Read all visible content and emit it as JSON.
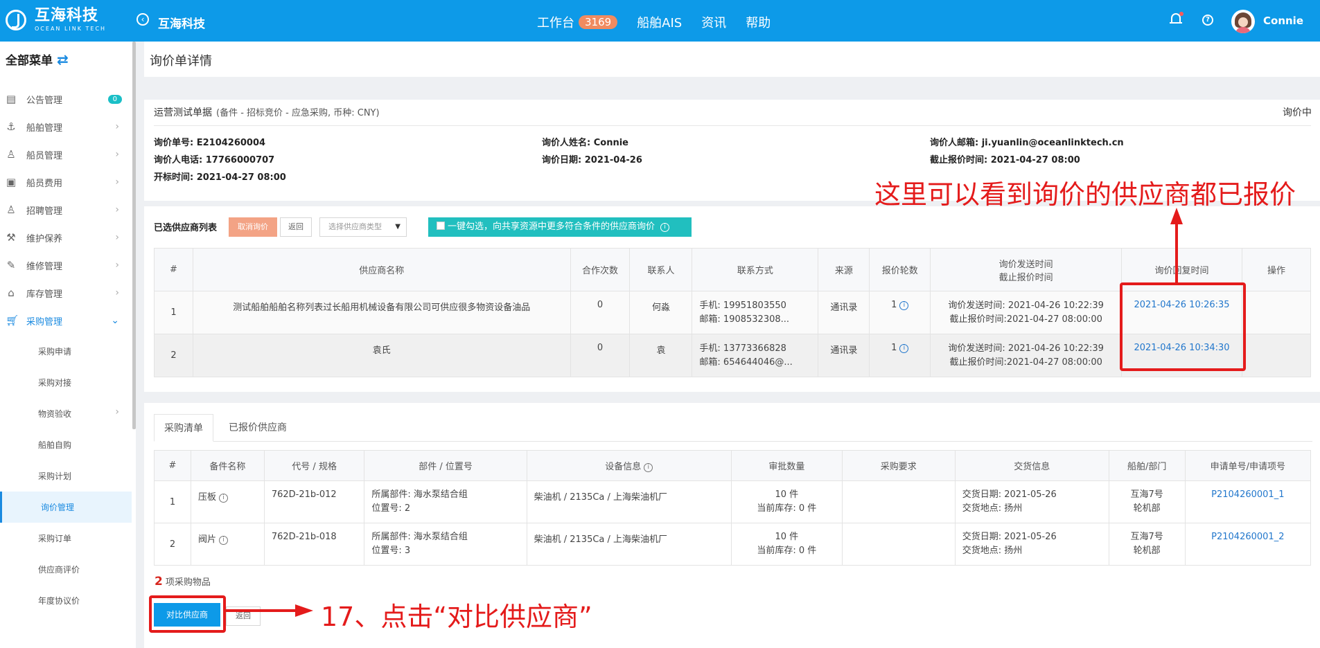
{
  "topbar": {
    "logo_cn": "互海科技",
    "logo_en": "OCEAN LINK TECH",
    "back_title": "互海科技",
    "nav": [
      {
        "label": "工作台",
        "badge": "3169"
      },
      {
        "label": "船舶AIS"
      },
      {
        "label": "资讯"
      },
      {
        "label": "帮助"
      }
    ],
    "user_name": "Connie"
  },
  "sidebar": {
    "header": "全部菜单",
    "items": [
      {
        "label": "公告管理",
        "icon": "book-icon",
        "badge": "0"
      },
      {
        "label": "船舶管理",
        "icon": "anchor-icon"
      },
      {
        "label": "船员管理",
        "icon": "person-icon"
      },
      {
        "label": "船员费用",
        "icon": "wallet-icon"
      },
      {
        "label": "招聘管理",
        "icon": "recruit-icon"
      },
      {
        "label": "维护保养",
        "icon": "wrench-icon"
      },
      {
        "label": "维修管理",
        "icon": "tool-icon"
      },
      {
        "label": "库存管理",
        "icon": "home-icon"
      },
      {
        "label": "采购管理",
        "icon": "cart-icon"
      }
    ],
    "subitems": [
      {
        "label": "采购申请"
      },
      {
        "label": "采购对接"
      },
      {
        "label": "物资验收"
      },
      {
        "label": "船舶自购"
      },
      {
        "label": "采购计划"
      },
      {
        "label": "询价管理"
      },
      {
        "label": "采购订单"
      },
      {
        "label": "供应商评价"
      },
      {
        "label": "年度协议价"
      }
    ]
  },
  "page": {
    "title": "询价单详情",
    "doc_name": "运营测试单据",
    "doc_sub": "(备件 - 招标竞价 - 应急采购, 币种: CNY)",
    "status": "询价中",
    "info": {
      "no": "询价单号: E2104260004",
      "phone": "询价人电话: 17766000707",
      "open_time": "开标时间: 2021-04-27 08:00",
      "name": "询价人姓名: Connie",
      "date": "询价日期: 2021-04-26",
      "email": "询价人邮箱: ji.yuanlin@oceanlinktech.cn",
      "deadline": "截止报价时间: 2021-04-27 08:00"
    }
  },
  "suppliers": {
    "label": "已选供应商列表",
    "cancel_btn": "取消询价",
    "back_btn": "返回",
    "type_select": "选择供应商类型",
    "share_text": "一键勾选，向共享资源中更多符合条件的供应商询价",
    "headers": [
      "#",
      "供应商名称",
      "合作次数",
      "联系人",
      "联系方式",
      "来源",
      "报价轮数",
      "询价发送时间",
      "截止报价时间",
      "询价回复时间",
      "操作"
    ],
    "rows": [
      {
        "idx": "1",
        "name": "测试船舶船舶名称列表过长船用机械设备有限公司可供应很多物资设备油品",
        "coop": "0",
        "contact": "何淼",
        "mobile": "手机:  19951803550",
        "email": "邮箱:  1908532308...",
        "source": "通讯录",
        "rounds": "1",
        "send": "询价发送时间: 2021-04-26 10:22:39",
        "deadline": "截止报价时间:2021-04-27 08:00:00",
        "reply": "2021-04-26 10:26:35"
      },
      {
        "idx": "2",
        "name": "袁氏",
        "coop": "0",
        "contact": "袁",
        "mobile": "手机:  13773366828",
        "email": "邮箱:  654644046@...",
        "source": "通讯录",
        "rounds": "1",
        "send": "询价发送时间: 2021-04-26 10:22:39",
        "deadline": "截止报价时间:2021-04-27 08:00:00",
        "reply": "2021-04-26 10:34:30"
      }
    ]
  },
  "purchase": {
    "tabs": [
      "采购清单",
      "已报价供应商"
    ],
    "headers": [
      "#",
      "备件名称",
      "代号 / 规格",
      "部件 / 位置号",
      "设备信息",
      "审批数量",
      "采购要求",
      "交货信息",
      "船舶/部门",
      "申请单号/申请项号"
    ],
    "rows": [
      {
        "idx": "1",
        "name": "压板",
        "code": "762D-21b-012",
        "part": "所属部件:  海水泵结合组",
        "pos": "位置号:  2",
        "equip": "柴油机 / 2135Ca / 上海柴油机厂",
        "qty": "10 件",
        "stock": "当前库存:  0 件",
        "req": "",
        "del_date": "交货日期:    2021-05-26",
        "del_place": "交货地点:  扬州",
        "ship": "互海7号",
        "dept": "轮机部",
        "apply": "P2104260001_1"
      },
      {
        "idx": "2",
        "name": "阀片",
        "code": "762D-21b-018",
        "part": "所属部件:  海水泵结合组",
        "pos": "位置号:  3",
        "equip": "柴油机 / 2135Ca / 上海柴油机厂",
        "qty": "10 件",
        "stock": "当前库存:  0 件",
        "req": "",
        "del_date": "交货日期:    2021-05-26",
        "del_place": "交货地点:  扬州",
        "ship": "互海7号",
        "dept": "轮机部",
        "apply": "P2104260001_2"
      }
    ],
    "count": "2",
    "count_label": "项采购物品",
    "compare_btn": "对比供应商",
    "back_btn": "返回"
  },
  "annotations": {
    "top": "这里可以看到询价的供应商都已报价",
    "bottom": "17、点击“对比供应商”",
    "color": "#e41b1b"
  }
}
